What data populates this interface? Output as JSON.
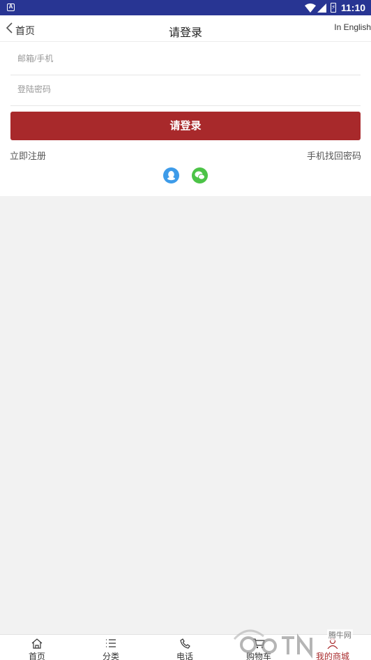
{
  "status_bar": {
    "app_badge": "A",
    "time": "11:10",
    "icons": [
      "wifi-icon",
      "signal-icon",
      "battery-charging-icon"
    ]
  },
  "header": {
    "back_label": "首页",
    "title": "请登录",
    "language_link": "In English"
  },
  "login_form": {
    "account_placeholder": "邮箱/手机",
    "account_value": "",
    "password_placeholder": "登陆密码",
    "password_value": "",
    "submit_label": "请登录",
    "register_link": "立即注册",
    "recover_link": "手机找回密码",
    "social_logins": [
      "qq-icon",
      "wechat-icon"
    ]
  },
  "tab_bar": {
    "items": [
      {
        "label": "首页",
        "icon": "home-icon"
      },
      {
        "label": "分类",
        "icon": "list-icon"
      },
      {
        "label": "电话",
        "icon": "phone-icon"
      },
      {
        "label": "购物车",
        "icon": "cart-icon"
      },
      {
        "label": "我的商城",
        "icon": "user-icon",
        "active": true
      }
    ]
  },
  "watermark": {
    "brand": "腾牛网"
  },
  "colors": {
    "status_bar": "#283593",
    "accent": "#a8292b",
    "page_background": "#f2f2f2",
    "qq": "#3d9be9",
    "wechat": "#4cc347"
  }
}
